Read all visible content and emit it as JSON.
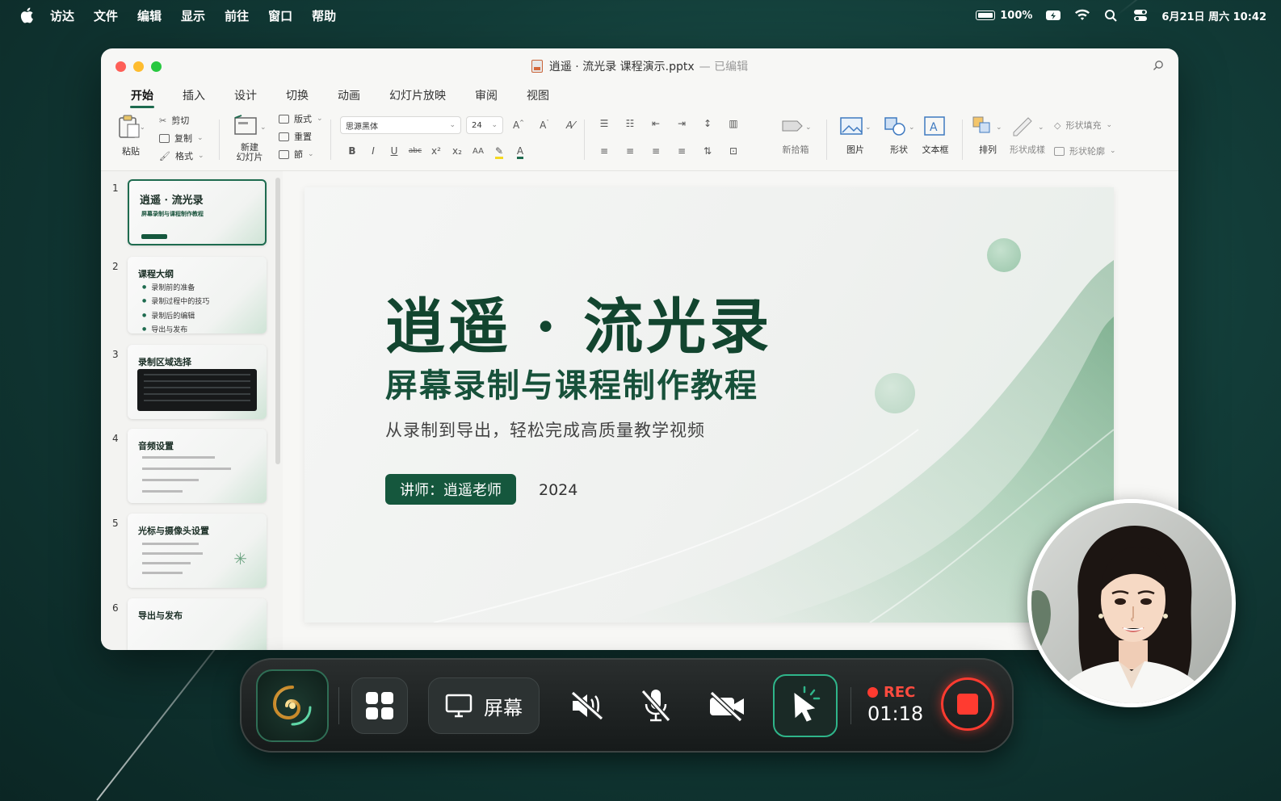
{
  "menubar": {
    "app": "访达",
    "items": [
      "文件",
      "编辑",
      "显示",
      "前往",
      "窗口",
      "帮助"
    ],
    "battery": "100%",
    "datetime": "6月21日 周六 10:42"
  },
  "window": {
    "filename": "逍遥 · 流光录 课程演示.pptx",
    "status": "— 已编辑"
  },
  "tabs": [
    "开始",
    "插入",
    "设计",
    "切换",
    "动画",
    "幻灯片放映",
    "审阅",
    "视图"
  ],
  "ribbon": {
    "paste": "粘贴",
    "cut": "剪切",
    "copy": "复制",
    "format": "格式",
    "new_slide": "新建\n幻灯片",
    "layout": "版式",
    "reset": "重置",
    "section": "節",
    "font": "思源黑体",
    "font_size": "24",
    "format_buttons": [
      "B",
      "I",
      "U",
      "abc",
      "x²",
      "x₂",
      "AA"
    ],
    "smartart": "新拾箱",
    "picture": "图片",
    "shape": "形状",
    "textbox": "文本框",
    "arrange": "排列",
    "quick_styles": "形状成樣",
    "shape_fill": "形状填充",
    "shape_outline": "形状轮廓"
  },
  "thumbnails": [
    {
      "num": "1",
      "title": "逍遥 · 流光录",
      "subtitle": "屏幕录制与课程制作教程"
    },
    {
      "num": "2",
      "title": "课程大纲",
      "bullets": [
        "录制前的准备",
        "录制过程中的技巧",
        "录制后的编辑",
        "导出与发布"
      ]
    },
    {
      "num": "3",
      "title": "录制区域选择"
    },
    {
      "num": "4",
      "title": "音频设置"
    },
    {
      "num": "5",
      "title": "光标与摄像头设置"
    },
    {
      "num": "6",
      "title": "导出与发布"
    }
  ],
  "slide": {
    "title": "逍遥 · 流光录",
    "subtitle": "屏幕录制与课程制作教程",
    "description": "从录制到导出，轻松完成高质量教学视频",
    "speaker": "讲师：逍遥老师",
    "year": "2024"
  },
  "recorder": {
    "screen_label": "屏幕",
    "rec_label": "REC",
    "elapsed": "01:18",
    "accent": "#2fb58a",
    "rec_color": "#ff3b30"
  }
}
